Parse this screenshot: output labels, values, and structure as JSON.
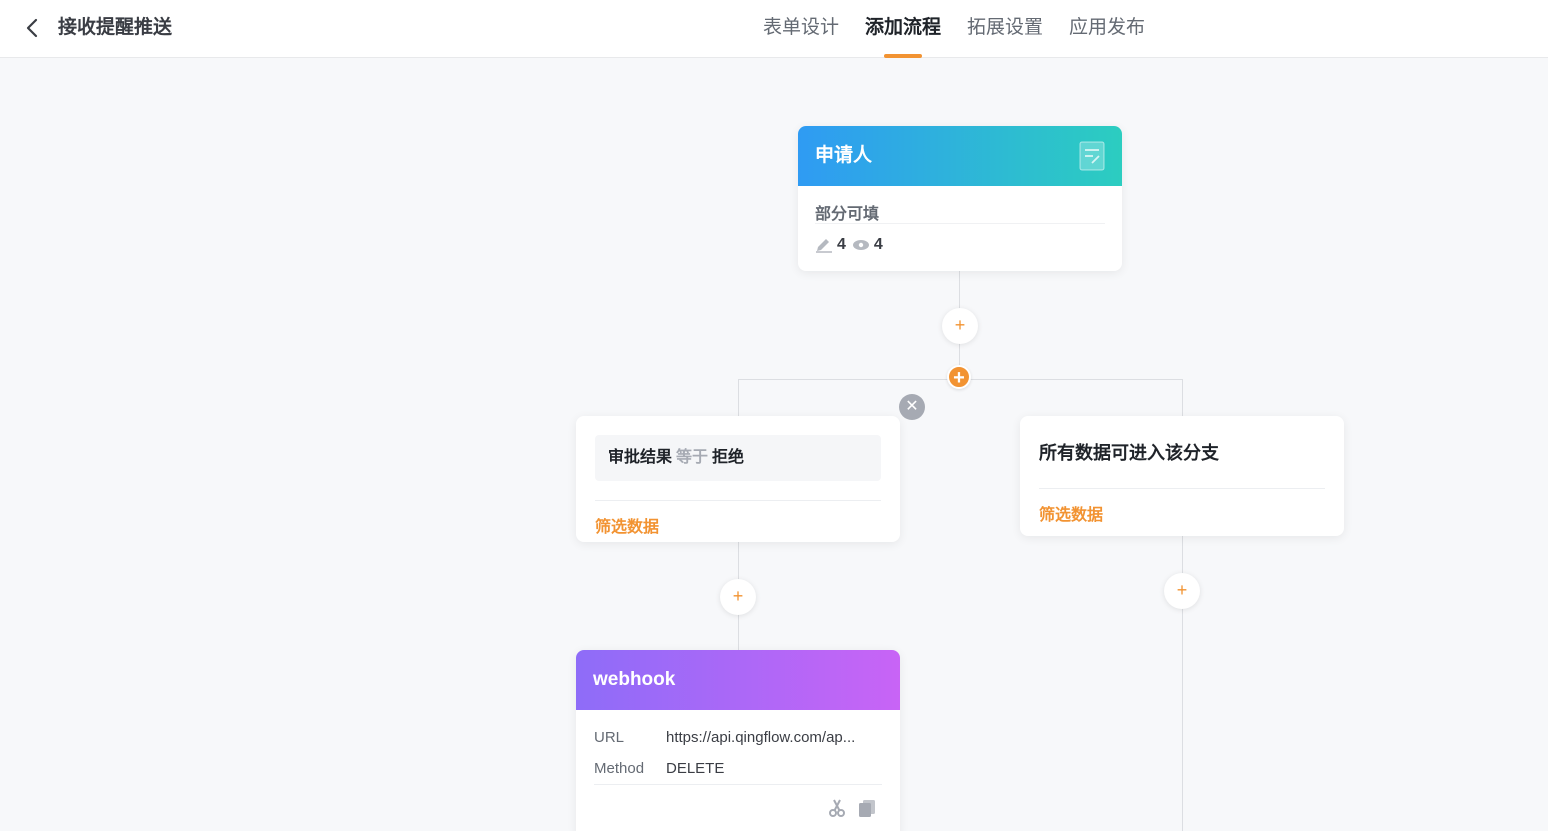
{
  "header": {
    "title": "接收提醒推送",
    "tabs": [
      {
        "label": "表单设计"
      },
      {
        "label": "添加流程"
      },
      {
        "label": "拓展设置"
      },
      {
        "label": "应用发布"
      }
    ],
    "active_tab": "添加流程"
  },
  "applicant_node": {
    "title": "申请人",
    "subtitle": "部分可填",
    "editable_count": "4",
    "visible_count": "4"
  },
  "add_button": {
    "symbol": "+"
  },
  "branch_add_button": {
    "symbol": "+"
  },
  "close_button": {
    "symbol": "✕"
  },
  "branch_left": {
    "field": "审批结果",
    "operator": "等于",
    "value": "拒绝",
    "filter_label": "筛选数据"
  },
  "branch_right": {
    "title": "所有数据可进入该分支",
    "filter_label": "筛选数据"
  },
  "webhook_node": {
    "title": "webhook",
    "url_label": "URL",
    "url_value": "https://api.qingflow.com/ap...",
    "method_label": "Method",
    "method_value": "DELETE"
  },
  "colors": {
    "accent": "#f29332",
    "applicant_gradient_start": "#2f9bf3",
    "applicant_gradient_end": "#2ccdc0",
    "webhook_gradient_start": "#8e6cf8",
    "webhook_gradient_end": "#c864f6"
  },
  "icons": [
    "chevron-left-icon",
    "document-edit-icon",
    "pencil-icon",
    "eye-icon",
    "scissors-icon",
    "copy-icon"
  ]
}
